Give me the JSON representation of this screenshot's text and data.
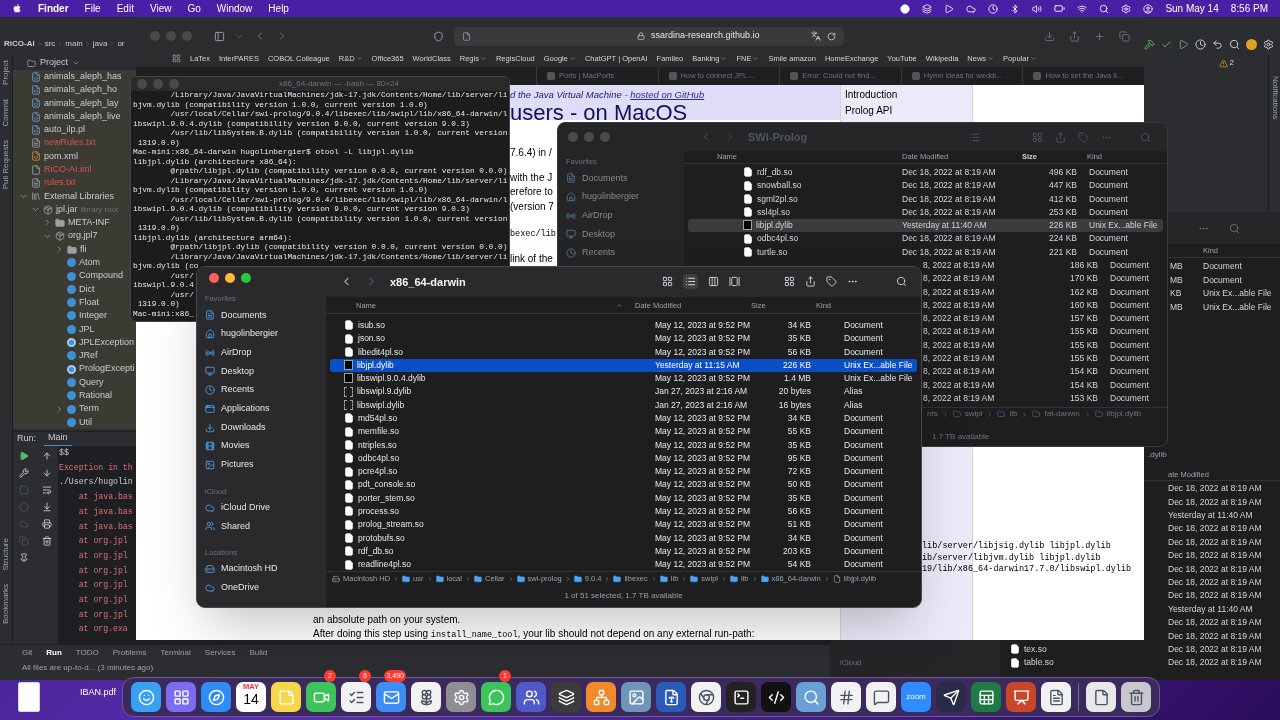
{
  "menubar": {
    "menus": [
      "Finder",
      "File",
      "Edit",
      "View",
      "Go",
      "Window",
      "Help"
    ],
    "date": "Sun May 14",
    "time": "8:56 PM"
  },
  "ide": {
    "breadcrumb": [
      "RiCO-AI",
      "src",
      "main",
      "java",
      "or"
    ],
    "warnings": "2",
    "project_title": "Project",
    "side_tabs_top": [
      "Project",
      "Commit",
      "Pull Requests"
    ],
    "side_tabs_bottom": [
      "Structure",
      "Bookmarks"
    ],
    "right_side_tab": "Notifications",
    "tree": [
      {
        "label": "animals_aleph_has",
        "kind": "pl",
        "untracked": false
      },
      {
        "label": "animals_aleph_ho",
        "kind": "pl",
        "untracked": false
      },
      {
        "label": "animals_aleph_lay",
        "kind": "pl",
        "untracked": false
      },
      {
        "label": "animals_aleph_live",
        "kind": "pl",
        "untracked": false
      },
      {
        "label": "auto_ilp.pl",
        "kind": "pl",
        "untracked": false
      },
      {
        "label": "newRules.txt",
        "kind": "txt",
        "untracked": true
      },
      {
        "label": "pom.xml",
        "kind": "xml",
        "untracked": false
      },
      {
        "label": "RiCO-AI.iml",
        "kind": "iml",
        "untracked": true
      },
      {
        "label": "rules.txt",
        "kind": "txt",
        "untracked": true
      },
      {
        "label": "External Libraries",
        "kind": "libraries",
        "expanded": true,
        "children": [
          {
            "label": "jpl.jar",
            "kind": "jar",
            "note": "library root",
            "expanded": true,
            "children": [
              {
                "label": "META-INF",
                "kind": "folder",
                "expanded": false
              },
              {
                "label": "org.jpl7",
                "kind": "package",
                "expanded": true,
                "children": [
                  {
                    "label": "fli",
                    "kind": "folder",
                    "expanded": false
                  },
                  {
                    "label": "Atom",
                    "kind": "class"
                  },
                  {
                    "label": "Compound",
                    "kind": "class"
                  },
                  {
                    "label": "Dict",
                    "kind": "class"
                  },
                  {
                    "label": "Float",
                    "kind": "class"
                  },
                  {
                    "label": "Integer",
                    "kind": "class"
                  },
                  {
                    "label": "JPL",
                    "kind": "class"
                  },
                  {
                    "label": "JPLException",
                    "kind": "exception"
                  },
                  {
                    "label": "JRef",
                    "kind": "class"
                  },
                  {
                    "label": "PrologExcepti",
                    "kind": "exception"
                  },
                  {
                    "label": "Query",
                    "kind": "class"
                  },
                  {
                    "label": "Rational",
                    "kind": "class"
                  },
                  {
                    "label": "Term",
                    "kind": "class",
                    "expanded": false
                  },
                  {
                    "label": "Util",
                    "kind": "class"
                  }
                ]
              }
            ]
          }
        ]
      }
    ],
    "run": {
      "label": "Run:",
      "tab": "Main",
      "lines": [
        {
          "text": "$$",
          "kind": "plain"
        },
        {
          "text": "Exception in th",
          "kind": "error"
        },
        {
          "text": "./Users/hugolin",
          "kind": "plain"
        },
        {
          "text": "    at java.bas",
          "kind": "error"
        },
        {
          "text": "    at java.bas",
          "kind": "error"
        },
        {
          "text": "    at java.bas",
          "kind": "error"
        },
        {
          "text": "    at org.jpl",
          "kind": "error"
        },
        {
          "text": "    at org.jpl",
          "kind": "error"
        },
        {
          "text": "    at org.jpl",
          "kind": "error"
        },
        {
          "text": "    at org.jpl",
          "kind": "error"
        },
        {
          "text": "    at org.jpl",
          "kind": "error"
        },
        {
          "text": "    at org.jpl",
          "kind": "error"
        },
        {
          "text": "    at org.exa",
          "kind": "error"
        }
      ]
    },
    "tool_tabs": [
      {
        "label": "Git",
        "selected": false
      },
      {
        "label": "Run",
        "selected": true
      },
      {
        "label": "TODO",
        "selected": false
      },
      {
        "label": "Problems",
        "selected": false
      },
      {
        "label": "Terminal",
        "selected": false
      },
      {
        "label": "Services",
        "selected": false
      },
      {
        "label": "Build",
        "selected": false
      }
    ],
    "status": "All files are up-to-d... (3 minutes ago)"
  },
  "browser": {
    "url": "ssardina-research.github.io",
    "bookmarks": [
      {
        "label": "LaTex",
        "menu": false
      },
      {
        "label": "InterPARES",
        "menu": false
      },
      {
        "label": "COBOL Colleague",
        "menu": false
      },
      {
        "label": "R&D",
        "menu": true
      },
      {
        "label": "Office365",
        "menu": false
      },
      {
        "label": "WorldClass",
        "menu": false
      },
      {
        "label": "Regis",
        "menu": true
      },
      {
        "label": "RegisCloud",
        "menu": false
      },
      {
        "label": "Google",
        "menu": true
      },
      {
        "label": "ChatGPT | OpenAI",
        "menu": false
      },
      {
        "label": "Famileo",
        "menu": false
      },
      {
        "label": "Banking",
        "menu": true
      },
      {
        "label": "FNE",
        "menu": true
      },
      {
        "label": "Smile amazon",
        "menu": false
      },
      {
        "label": "HomeExchange",
        "menu": false
      },
      {
        "label": "YouTube",
        "menu": false
      },
      {
        "label": "Wikipedia",
        "menu": false
      },
      {
        "label": "News",
        "menu": true
      },
      {
        "label": "Popular",
        "menu": true
      }
    ],
    "tabs": [
      "Ports | MacPorts",
      "How to connect JPL...",
      "Error: Could not find...",
      "Hymn ideas for weddi...",
      "How to set the Java li..."
    ],
    "subtitle": "d the Java Virtual Machine - ",
    "subtitle_link": "hosted on GitHub",
    "title": "users - on MacOS",
    "nav": [
      "Introduction",
      "Prolog API"
    ],
    "fragments": [
      {
        "parts": [
          {
            "text": "7.6.4) in /",
            "kind": "prose"
          }
        ]
      },
      {
        "parts": [
          {
            "text": "with the J",
            "kind": "prose"
          }
        ]
      },
      {
        "parts": [
          {
            "text": "erefore to",
            "kind": "prose"
          }
        ]
      },
      {
        "parts": [
          {
            "text": "(version 7",
            "kind": "prose"
          }
        ]
      },
      {
        "parts": [
          {
            "text": "bexec/lib",
            "kind": "code"
          }
        ]
      },
      {
        "parts": [
          {
            "text": "link of the",
            "kind": "prose"
          }
        ]
      },
      {
        "parts": [
          {
            "text": "lib/server/libjsig.dylib libjpl.dylib",
            "kind": "code"
          }
        ]
      },
      {
        "parts": [
          {
            "text": "ib/server/libjvm.dylib libjpl.dylib",
            "kind": "code"
          }
        ]
      },
      {
        "parts": [
          {
            "text": "19/lib/x86_64-darwin17.7.0/libswipl.dylib",
            "kind": "code"
          }
        ]
      },
      {
        "parts": [
          {
            "text": "an absolute path on your system.",
            "kind": "prose"
          }
        ]
      },
      {
        "parts": [
          {
            "text": "After doing this step using ",
            "kind": "prose"
          },
          {
            "text": "install_name_tool",
            "kind": "code"
          },
          {
            "text": ", your lib should not depend on any external run-path:",
            "kind": "prose"
          }
        ]
      }
    ]
  },
  "terminal": {
    "title": "x86_64-darwin — -bash — 80×24",
    "lines": [
      "        /Library/Java/JavaVirtualMachines/jdk-17.jdk/Contents/Home/lib/server/li",
      "bjvm.dylib (compatibility version 1.0.0, current version 1.0.0)",
      "        /usr/local/Cellar/swi-prolog/9.0.4/libexec/lib/swipl/lib/x86_64-darwin/l",
      "ibswipl.9.0.4.dylib (compatibility version 9.0.0, current version 9.0.3)",
      "        /usr/lib/libSystem.B.dylib (compatibility version 1.0.0, current version",
      " 1319.0.0)",
      "Mac-mini:x86_64-darwin hugolinbergier$ otool -L libjpl.dylib",
      "libjpl.dylib (architecture x86_64):",
      "        @rpath/libjpl.dylib (compatibility version 0.0.0, current version 0.0.0)",
      "        /Library/Java/JavaVirtualMachines/jdk-17.jdk/Contents/Home/lib/server/li",
      "bjvm.dylib (compatibility version 1.0.0, current version 1.0.0)",
      "        /usr/local/Cellar/swi-prolog/9.0.4/libexec/lib/swipl/lib/x86_64-darwin/l",
      "ibswipl.9.0.4.dylib (compatibility version 9.0.0, current version 9.0.3)",
      "        /usr/lib/libSystem.B.dylib (compatibility version 1.0.0, current version",
      " 1319.0.0)",
      "libjpl.dylib (architecture arm64):",
      "        @rpath/libjpl.dylib (compatibility version 0.0.0, current version 0.0.0)",
      "        /Library/Java/JavaVirtualMachines/jdk-17.jdk/Contents/Home/lib/server/li",
      "bjvm.dylib (co",
      "        /usr/",
      "ibswipl.9.0.4",
      "        /usr/",
      " 1319.0.0)",
      "Mac-mini:x86_"
    ]
  },
  "back_finder": {
    "title": "SWI-Prolog",
    "sidebar": [
      {
        "heading": "Favorites",
        "items": [
          "Documents",
          "hugolinbergier",
          "AirDrop",
          "Desktop",
          "Recents"
        ]
      }
    ],
    "columns": [
      "Name",
      "Date Modified",
      "Size",
      "Kind"
    ],
    "rows": [
      {
        "name": "rdf_db.so",
        "kind": "document",
        "date": "Dec 18, 2022 at 8:19 AM",
        "size": "496 KB",
        "kind_text": "Document",
        "selected": false
      },
      {
        "name": "snowball.so",
        "kind": "document",
        "date": "Dec 18, 2022 at 8:19 AM",
        "size": "447 KB",
        "kind_text": "Document",
        "selected": false
      },
      {
        "name": "sgml2pl.so",
        "kind": "document",
        "date": "Dec 18, 2022 at 8:19 AM",
        "size": "412 KB",
        "kind_text": "Document",
        "selected": false
      },
      {
        "name": "ssl4pl.so",
        "kind": "document",
        "date": "Dec 18, 2022 at 8:19 AM",
        "size": "253 KB",
        "kind_text": "Document",
        "selected": false
      },
      {
        "name": "libjpl.dylib",
        "kind": "executable",
        "date": "Yesterday at 11:40 AM",
        "size": "226 KB",
        "kind_text": "Unix Ex...able File",
        "selected": true
      },
      {
        "name": "odbc4pl.so",
        "kind": "document",
        "date": "Dec 18, 2022 at 8:19 AM",
        "size": "224 KB",
        "kind_text": "Document",
        "selected": false
      },
      {
        "name": "turtle.so",
        "kind": "document",
        "date": "Dec 18, 2022 at 8:19 AM",
        "size": "221 KB",
        "kind_text": "Document",
        "selected": false
      },
      {
        "date": "8, 2022 at 8:19 AM",
        "size": "186 KB",
        "kind_text": "Document",
        "selected": false
      },
      {
        "date": "8, 2022 at 8:19 AM",
        "size": "170 KB",
        "kind_text": "Document",
        "selected": false
      },
      {
        "date": "8, 2022 at 8:19 AM",
        "size": "162 KB",
        "kind_text": "Document",
        "selected": false
      },
      {
        "date": "8, 2022 at 8:19 AM",
        "size": "160 KB",
        "kind_text": "Document",
        "selected": false
      },
      {
        "date": "8, 2022 at 8:19 AM",
        "size": "157 KB",
        "kind_text": "Document",
        "selected": false
      },
      {
        "date": "8, 2022 at 8:19 AM",
        "size": "155 KB",
        "kind_text": "Document",
        "selected": false
      },
      {
        "date": "8, 2022 at 8:19 AM",
        "size": "155 KB",
        "kind_text": "Document",
        "selected": false
      },
      {
        "date": "8, 2022 at 8:19 AM",
        "size": "155 KB",
        "kind_text": "Document",
        "selected": false
      },
      {
        "date": "8, 2022 at 8:19 AM",
        "size": "154 KB",
        "kind_text": "Document",
        "selected": false
      },
      {
        "date": "8, 2022 at 8:19 AM",
        "size": "154 KB",
        "kind_text": "Document",
        "selected": false
      },
      {
        "date": "8, 2022 at 8:19 AM",
        "size": "153 KB",
        "kind_text": "Document",
        "selected": false
      }
    ],
    "path": [
      "nts",
      "swipl",
      "lib",
      "fat-darwin",
      "libjpl.dylib"
    ],
    "status": "1.7 TB available"
  },
  "side_finder": {
    "header": "Kind",
    "rows": [
      {
        "size": "MB",
        "kind_text": "Document"
      },
      {
        "size": "MB",
        "kind_text": "Document"
      },
      {
        "size": "KB",
        "kind_text": "Unix Ex...able File"
      },
      {
        "size": "MB",
        "kind_text": "Unix Ex...able File"
      }
    ]
  },
  "lower_finder": {
    "top_fragment": ".dylib",
    "date_header": "ate Modified",
    "sidebar_heading": "iCloud",
    "rows": [
      {
        "date": "Dec 18, 2022 at 8:19 AM"
      },
      {
        "date": "Dec 18, 2022 at 8:19 AM"
      },
      {
        "date": "Yesterday at 11:40 AM"
      },
      {
        "date": "Dec 18, 2022 at 8:19 AM"
      },
      {
        "date": "Dec 18, 2022 at 8:19 AM"
      },
      {
        "date": "Dec 18, 2022 at 8:19 AM"
      },
      {
        "date": "Dec 18, 2022 at 8:19 AM"
      },
      {
        "date": "Dec 18, 2022 at 8:19 AM"
      },
      {
        "date": "Dec 18, 2022 at 8:19 AM"
      },
      {
        "date": "Yesterday at 11:40 AM"
      },
      {
        "date": "Dec 18, 2022 at 8:19 AM"
      },
      {
        "date": "Dec 18, 2022 at 8:19 AM"
      },
      {
        "name": "tex.so",
        "date": "Dec 18, 2022 at 8:19 AM"
      },
      {
        "name": "table.so",
        "date": "Dec 18, 2022 at 8:19 AM"
      }
    ]
  },
  "finder": {
    "title": "x86_64-darwin",
    "sidebar": [
      {
        "heading": "Favorites",
        "items": [
          "Documents",
          "hugolinbergier",
          "AirDrop",
          "Desktop",
          "Recents",
          "Applications",
          "Downloads",
          "Movies",
          "Pictures"
        ]
      },
      {
        "heading": "iCloud",
        "items": [
          "iCloud Drive",
          "Shared"
        ]
      },
      {
        "heading": "Locations",
        "items": [
          "Macintosh HD",
          "OneDrive"
        ]
      }
    ],
    "columns": [
      "Name",
      "Date Modified",
      "Size",
      "Kind"
    ],
    "rows": [
      {
        "name": "isub.so",
        "kind": "document",
        "date": "May 12, 2023 at 9:52 PM",
        "size": "34 KB",
        "kind_text": "Document",
        "selected": false
      },
      {
        "name": "json.so",
        "kind": "document",
        "date": "May 12, 2023 at 9:52 PM",
        "size": "35 KB",
        "kind_text": "Document",
        "selected": false
      },
      {
        "name": "libedit4pl.so",
        "kind": "document",
        "date": "May 12, 2023 at 9:52 PM",
        "size": "56 KB",
        "kind_text": "Document",
        "selected": false
      },
      {
        "name": "libjpl.dylib",
        "kind": "executable",
        "date": "Yesterday at 11:15 AM",
        "size": "226 KB",
        "kind_text": "Unix Ex...able File",
        "selected": true
      },
      {
        "name": "libswipl.9.0.4.dylib",
        "kind": "executable",
        "date": "May 12, 2023 at 9:52 PM",
        "size": "1.4 MB",
        "kind_text": "Unix Ex...able File",
        "selected": false
      },
      {
        "name": "libswipl.9.dylib",
        "kind": "alias",
        "date": "Jan 27, 2023 at 2:16 AM",
        "size": "20 bytes",
        "kind_text": "Alias",
        "selected": false
      },
      {
        "name": "libswipl.dylib",
        "kind": "alias",
        "date": "Jan 27, 2023 at 2:16 AM",
        "size": "16 bytes",
        "kind_text": "Alias",
        "selected": false
      },
      {
        "name": "md54pl.so",
        "kind": "document",
        "date": "May 12, 2023 at 9:52 PM",
        "size": "34 KB",
        "kind_text": "Document",
        "selected": false
      },
      {
        "name": "memfile.so",
        "kind": "document",
        "date": "May 12, 2023 at 9:52 PM",
        "size": "55 KB",
        "kind_text": "Document",
        "selected": false
      },
      {
        "name": "ntriples.so",
        "kind": "document",
        "date": "May 12, 2023 at 9:52 PM",
        "size": "35 KB",
        "kind_text": "Document",
        "selected": false
      },
      {
        "name": "odbc4pl.so",
        "kind": "document",
        "date": "May 12, 2023 at 9:52 PM",
        "size": "95 KB",
        "kind_text": "Document",
        "selected": false
      },
      {
        "name": "pcre4pl.so",
        "kind": "document",
        "date": "May 12, 2023 at 9:52 PM",
        "size": "72 KB",
        "kind_text": "Document",
        "selected": false
      },
      {
        "name": "pdt_console.so",
        "kind": "document",
        "date": "May 12, 2023 at 9:52 PM",
        "size": "50 KB",
        "kind_text": "Document",
        "selected": false
      },
      {
        "name": "porter_stem.so",
        "kind": "document",
        "date": "May 12, 2023 at 9:52 PM",
        "size": "35 KB",
        "kind_text": "Document",
        "selected": false
      },
      {
        "name": "process.so",
        "kind": "document",
        "date": "May 12, 2023 at 9:52 PM",
        "size": "56 KB",
        "kind_text": "Document",
        "selected": false
      },
      {
        "name": "prolog_stream.so",
        "kind": "document",
        "date": "May 12, 2023 at 9:52 PM",
        "size": "51 KB",
        "kind_text": "Document",
        "selected": false
      },
      {
        "name": "protobufs.so",
        "kind": "document",
        "date": "May 12, 2023 at 9:52 PM",
        "size": "34 KB",
        "kind_text": "Document",
        "selected": false
      },
      {
        "name": "rdf_db.so",
        "kind": "document",
        "date": "May 12, 2023 at 9:52 PM",
        "size": "203 KB",
        "kind_text": "Document",
        "selected": false
      },
      {
        "name": "readline4pl.so",
        "kind": "document",
        "date": "May 12, 2023 at 9:52 PM",
        "size": "54 KB",
        "kind_text": "Document",
        "selected": false
      }
    ],
    "path": [
      "Macintosh HD",
      "usr",
      "local",
      "Cellar",
      "swi-prolog",
      "9.0.4",
      "libexec",
      "lib",
      "swipl",
      "lib",
      "x86_64-darwin",
      "libjpl.dylib"
    ],
    "status": "1 of 51 selected, 1.7 TB available"
  },
  "desktop_file": {
    "label": "IBAN.pdf"
  },
  "dock": [
    {
      "kind": "finder"
    },
    {
      "kind": "launchpad"
    },
    {
      "kind": "safari"
    },
    {
      "kind": "calendar",
      "month": "MAY",
      "day": "14"
    },
    {
      "kind": "notes"
    },
    {
      "kind": "facetime",
      "badge": "2"
    },
    {
      "kind": "reminders",
      "badge": "6"
    },
    {
      "kind": "mail",
      "badge": "3,490"
    },
    {
      "kind": "photos"
    },
    {
      "kind": "settings"
    },
    {
      "kind": "messages",
      "badge": "1"
    },
    {
      "kind": "teams"
    },
    {
      "kind": "sublime"
    },
    {
      "kind": "sourcetree"
    },
    {
      "kind": "preview"
    },
    {
      "kind": "word"
    },
    {
      "kind": "chrome"
    },
    {
      "kind": "terminal"
    },
    {
      "kind": "intellij"
    },
    {
      "kind": "quicktime"
    },
    {
      "kind": "slack"
    },
    {
      "kind": "feedback"
    },
    {
      "kind": "zoom",
      "label": "zoom"
    },
    {
      "kind": "vectorize"
    },
    {
      "kind": "excel"
    },
    {
      "kind": "powerpoint"
    },
    {
      "kind": "textedit"
    },
    {
      "kind": "separator"
    },
    {
      "kind": "document"
    },
    {
      "kind": "trash"
    }
  ]
}
